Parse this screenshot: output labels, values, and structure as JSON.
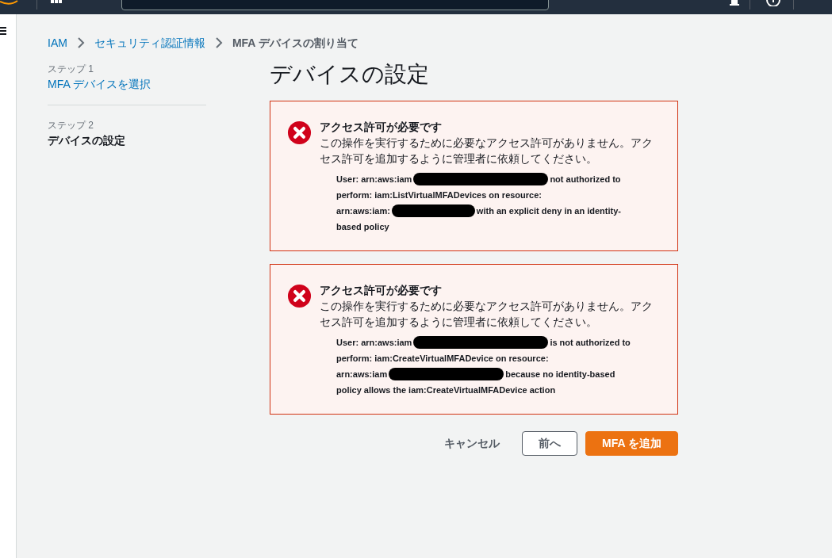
{
  "breadcrumb": [
    {
      "label": "IAM",
      "link": true
    },
    {
      "label": "セキュリティ認証情報",
      "link": true
    },
    {
      "label": "MFA デバイスの割り当て",
      "link": false
    }
  ],
  "steps": [
    {
      "step": "ステップ 1",
      "label": "MFA デバイスを選択",
      "selected": false
    },
    {
      "step": "ステップ 2",
      "label": "デバイスの設定",
      "selected": true
    }
  ],
  "title": "デバイスの設定",
  "alerts": [
    {
      "title": "アクセス許可が必要です",
      "message": "この操作を実行するために必要なアクセス許可がありません。アクセス許可を追加するように管理者に依頼してください。",
      "detail": [
        [
          {
            "kind": "text",
            "text": "User: arn:aws:iam"
          },
          {
            "kind": "redacted"
          },
          {
            "kind": "text",
            "text": "not authorized to"
          }
        ],
        [
          {
            "kind": "text",
            "text": "perform: iam:ListVirtualMFADevices on resource:"
          }
        ],
        [
          {
            "kind": "text",
            "text": "arn:aws:iam:"
          },
          {
            "kind": "redacted"
          },
          {
            "kind": "text",
            "text": "with an explicit deny in an identity-"
          }
        ],
        [
          {
            "kind": "text",
            "text": "based policy"
          }
        ]
      ]
    },
    {
      "title": "アクセス許可が必要です",
      "message": "この操作を実行するために必要なアクセス許可がありません。アクセス許可を追加するように管理者に依頼してください。",
      "detail": [
        [
          {
            "kind": "text",
            "text": "User: arn:aws:iam"
          },
          {
            "kind": "redacted"
          },
          {
            "kind": "text",
            "text": "is not authorized to"
          }
        ],
        [
          {
            "kind": "text",
            "text": "perform: iam:CreateVirtualMFADevice on resource:"
          }
        ],
        [
          {
            "kind": "text",
            "text": "arn:aws:iam"
          },
          {
            "kind": "redacted"
          },
          {
            "kind": "text",
            "text": "because no identity-based"
          }
        ],
        [
          {
            "kind": "text",
            "text": "policy allows the iam:CreateVirtualMFADevice action"
          }
        ]
      ]
    }
  ],
  "buttons": [
    {
      "label": "キャンセル",
      "kind": "link"
    },
    {
      "label": "前へ",
      "kind": "secondary"
    },
    {
      "label": "MFA を追加",
      "kind": "primary"
    }
  ]
}
